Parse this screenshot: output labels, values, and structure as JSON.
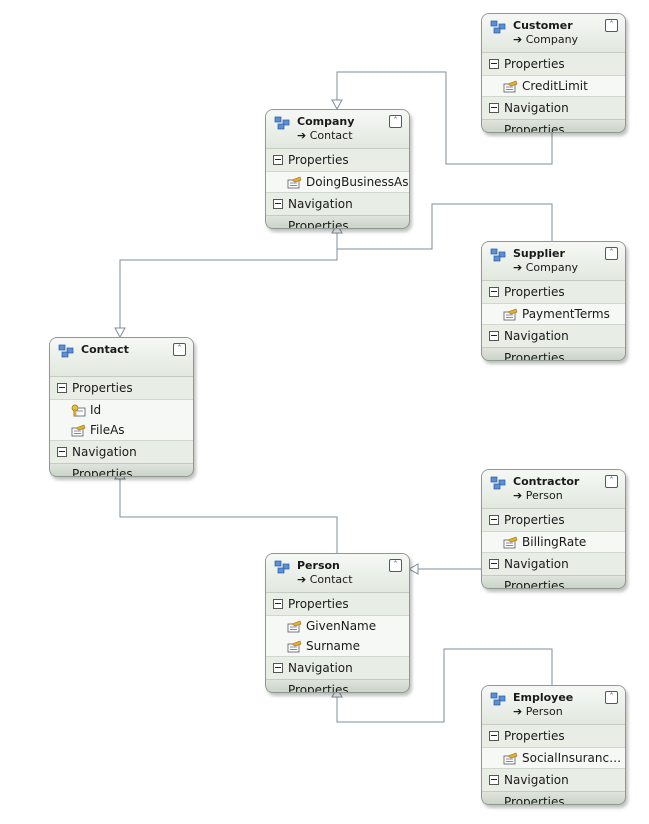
{
  "section_labels": {
    "properties": "Properties",
    "navigation": "Navigation Properties"
  },
  "colors": {
    "connector": "#7f8c99",
    "entity_border": "#8e9a8e"
  },
  "entities": [
    {
      "id": "customer",
      "name": "Customer",
      "base": "Company",
      "properties": [
        {
          "name": "CreditLimit",
          "key": false
        }
      ]
    },
    {
      "id": "company",
      "name": "Company",
      "base": "Contact",
      "properties": [
        {
          "name": "DoingBusinessAs",
          "key": false
        }
      ]
    },
    {
      "id": "supplier",
      "name": "Supplier",
      "base": "Company",
      "properties": [
        {
          "name": "PaymentTerms",
          "key": false
        }
      ]
    },
    {
      "id": "contact",
      "name": "Contact",
      "base": "",
      "properties": [
        {
          "name": "Id",
          "key": true
        },
        {
          "name": "FileAs",
          "key": false
        }
      ]
    },
    {
      "id": "contractor",
      "name": "Contractor",
      "base": "Person",
      "properties": [
        {
          "name": "BillingRate",
          "key": false
        }
      ]
    },
    {
      "id": "person",
      "name": "Person",
      "base": "Contact",
      "properties": [
        {
          "name": "GivenName",
          "key": false
        },
        {
          "name": "Surname",
          "key": false
        }
      ]
    },
    {
      "id": "employee",
      "name": "Employee",
      "base": "Person",
      "properties": [
        {
          "name": "SocialInsurance...",
          "key": false
        }
      ]
    }
  ],
  "inheritance": [
    {
      "from": "Customer",
      "to": "Company"
    },
    {
      "from": "Supplier",
      "to": "Company"
    },
    {
      "from": "Company",
      "to": "Contact"
    },
    {
      "from": "Person",
      "to": "Contact"
    },
    {
      "from": "Contractor",
      "to": "Person"
    },
    {
      "from": "Employee",
      "to": "Person"
    }
  ]
}
